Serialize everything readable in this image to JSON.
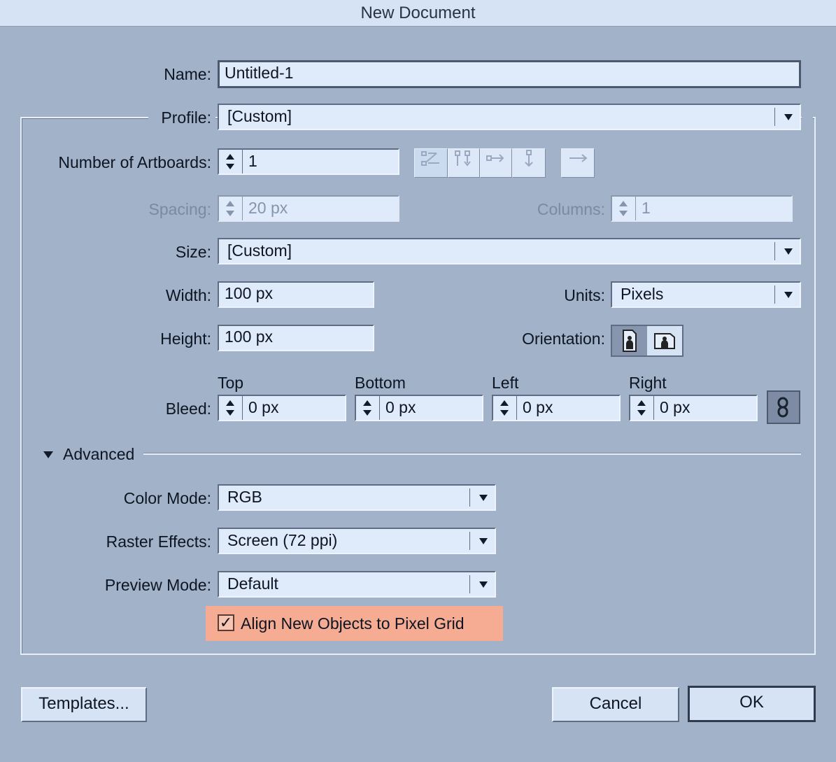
{
  "dialog": {
    "title": "New Document"
  },
  "name": {
    "label": "Name:",
    "value": "Untitled-1"
  },
  "profile": {
    "label": "Profile:",
    "value": "[Custom]"
  },
  "artboards": {
    "label": "Number of Artboards:",
    "value": "1",
    "spacing_label": "Spacing:",
    "spacing_value": "20 px",
    "columns_label": "Columns:",
    "columns_value": "1",
    "layout_icons": [
      "grid-by-row-icon",
      "grid-by-column-icon",
      "arrange-by-row-icon",
      "arrange-by-column-icon",
      "change-to-rtl-icon"
    ]
  },
  "size": {
    "label": "Size:",
    "value": "[Custom]"
  },
  "width": {
    "label": "Width:",
    "value": "100 px"
  },
  "height": {
    "label": "Height:",
    "value": "100 px"
  },
  "units": {
    "label": "Units:",
    "value": "Pixels"
  },
  "orientation": {
    "label": "Orientation:",
    "options": [
      "portrait",
      "landscape"
    ],
    "selected": "portrait"
  },
  "bleed": {
    "label": "Bleed:",
    "top_label": "Top",
    "top_value": "0 px",
    "bottom_label": "Bottom",
    "bottom_value": "0 px",
    "left_label": "Left",
    "left_value": "0 px",
    "right_label": "Right",
    "right_value": "0 px",
    "link_icon": "chain-link-icon"
  },
  "advanced": {
    "label": "Advanced",
    "color_mode_label": "Color Mode:",
    "color_mode_value": "RGB",
    "raster_label": "Raster Effects:",
    "raster_value": "Screen (72 ppi)",
    "preview_label": "Preview Mode:",
    "preview_value": "Default",
    "align_label": "Align New Objects to Pixel Grid",
    "align_checked": true,
    "highlight_color": "#f5ac93"
  },
  "buttons": {
    "templates": "Templates...",
    "cancel": "Cancel",
    "ok": "OK"
  },
  "colors": {
    "background": "#a2b2c9",
    "field": "#dfeafa",
    "titlebar": "#d5e3f5"
  }
}
